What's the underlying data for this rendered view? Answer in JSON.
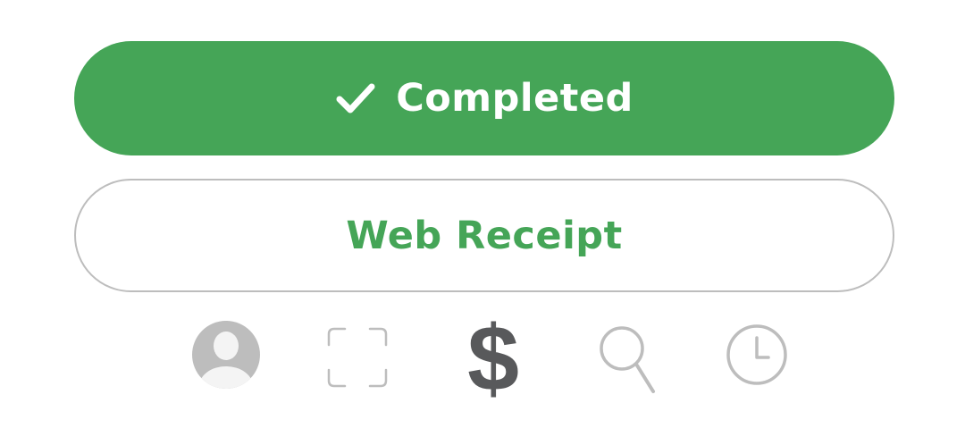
{
  "actions": {
    "completed_label": "Completed",
    "receipt_label": "Web Receipt"
  },
  "tabbar": {
    "items": [
      {
        "name": "profile",
        "icon": "person-icon"
      },
      {
        "name": "scan",
        "icon": "scan-frame-icon"
      },
      {
        "name": "money",
        "icon": "dollar-icon",
        "glyph": "$",
        "active": true
      },
      {
        "name": "search",
        "icon": "search-icon"
      },
      {
        "name": "history",
        "icon": "clock-icon"
      }
    ]
  },
  "colors": {
    "accent": "#45a557",
    "active_icon": "#58595b",
    "inactive_icon": "#bdbdbd",
    "border": "#bdbdbd"
  }
}
